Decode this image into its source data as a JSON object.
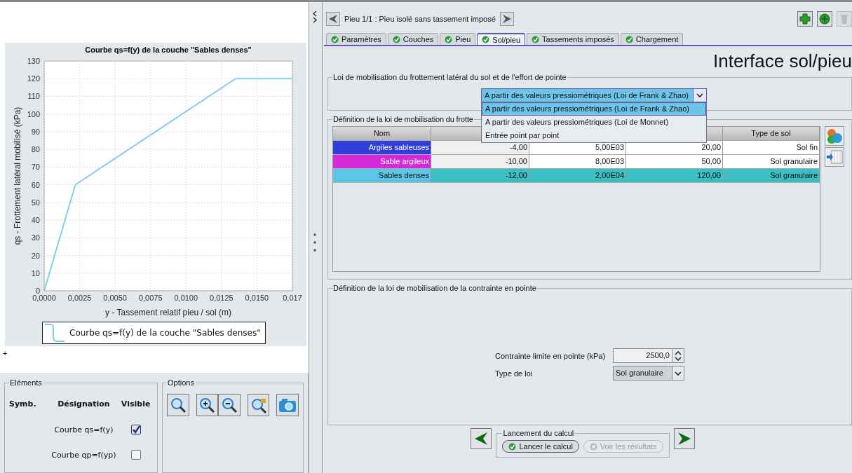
{
  "chart_panel": {
    "chart_data": {
      "type": "line",
      "title": "Courbe qs=f(y) de la couche \"Sables denses\"",
      "xlabel": "y - Tassement relatif pieu / sol (m)",
      "ylabel": "qs - Frottement latéral mobilisé (kPa)",
      "grid": true,
      "x": [
        0,
        0.0022,
        0.0135,
        0.0175
      ],
      "series": [
        {
          "name": "Courbe qs=f(y) de la couche \"Sables denses\"",
          "color": "#7fd0f0",
          "values": [
            0,
            60,
            120,
            120
          ]
        }
      ],
      "xlim": [
        0,
        0.0175
      ],
      "ylim": [
        0,
        130
      ],
      "xticks": [
        {
          "value": 0,
          "label": "0,0000"
        },
        {
          "value": 0.0025,
          "label": "0,0025"
        },
        {
          "value": 0.005,
          "label": "0,0050"
        },
        {
          "value": 0.0075,
          "label": "0,0075"
        },
        {
          "value": 0.01,
          "label": "0,0100"
        },
        {
          "value": 0.0125,
          "label": "0,0125"
        },
        {
          "value": 0.015,
          "label": "0,0150"
        },
        {
          "value": 0.0175,
          "label": "0,017"
        }
      ],
      "yticks": [
        0,
        10,
        20,
        30,
        40,
        50,
        60,
        70,
        80,
        90,
        100,
        110,
        120,
        130
      ]
    }
  },
  "cursor_mark": "+",
  "elements": {
    "title": "Eléments",
    "headers": [
      "Symb.",
      "Désignation",
      "Visible"
    ],
    "items": [
      {
        "designation": "Courbe qs=f(y)",
        "visible": true
      },
      {
        "designation": "Courbe qp=f(yp)",
        "visible": false
      }
    ]
  },
  "options": {
    "title": "Options"
  },
  "header": {
    "title": "Pieu 1/1 : Pieu isolé sans tassement imposé"
  },
  "tabs": [
    {
      "label": "Paramètres",
      "selected": false
    },
    {
      "label": "Couches",
      "selected": false
    },
    {
      "label": "Pieu",
      "selected": false
    },
    {
      "label": "Sol/pieu",
      "selected": true
    },
    {
      "label": "Tassements imposés",
      "selected": false
    },
    {
      "label": "Chargement",
      "selected": false
    }
  ],
  "page_title": "Interface sol/pieu",
  "law_section": {
    "title": "Loi de mobilisation du frottement latéral du sol et de l'effort de pointe",
    "value": "A partir des valeurs pressiométriques (Loi de Frank & Zhao)",
    "options": [
      {
        "label": "A partir des valeurs pressiométriques (Loi de Frank & Zhao)",
        "selected": true
      },
      {
        "label": "A partir des valeurs pressiométriques (Loi de Monnet)",
        "selected": false
      },
      {
        "label": "Entrée point par point",
        "selected": false
      }
    ]
  },
  "friction_section": {
    "title": "Définition de la loi de mobilisation du frotte",
    "columns": {
      "column_1": "Nom",
      "column_5": "Type de sol"
    },
    "rows": [
      {
        "name": "Argiles sableuses",
        "color": "#2d3fd8",
        "selected": false,
        "cells": [
          "-4,00",
          "5,00E03",
          "20,00",
          "Sol fin"
        ]
      },
      {
        "name": "Sable argileux",
        "color": "#d42ad8",
        "selected": false,
        "cells": [
          "-10,00",
          "8,00E03",
          "50,00",
          "Sol granulaire"
        ]
      },
      {
        "name": "Sables denses",
        "color": "#5cc6e6",
        "selected": true,
        "cells": [
          "-12,00",
          "2,00E04",
          "120,00",
          "Sol granulaire"
        ]
      }
    ]
  },
  "tip_section": {
    "title": "Définition de la loi de mobilisation de la contrainte en pointe",
    "limit_label": "Contrainte limite en pointe (kPa)",
    "limit_value": "2500,0",
    "type_label": "Type de loi",
    "type_value": "Sol granulaire"
  },
  "launch": {
    "title": "Lancement du calcul",
    "buttons": [
      {
        "label": "Lancer le calcul",
        "disabled": false
      },
      {
        "label": "Voir les résultats",
        "disabled": true
      }
    ]
  }
}
